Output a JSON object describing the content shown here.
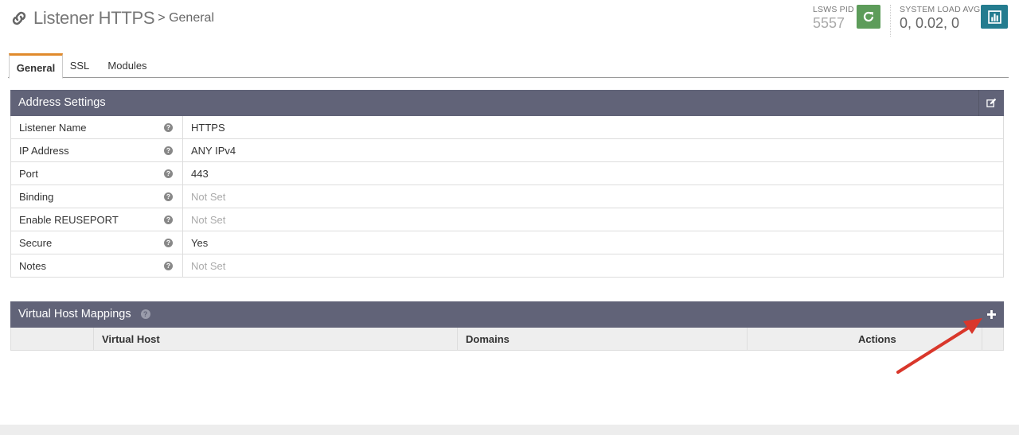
{
  "header": {
    "title": "Listener HTTPS",
    "subtitle": "> General",
    "pid_label": "LSWS PID",
    "pid_value": "5557",
    "load_label": "SYSTEM LOAD AVG",
    "load_value": "0, 0.02, 0",
    "icons": {
      "title": "link-icon",
      "restart": "refresh-icon",
      "stats": "bar-chart-icon"
    },
    "colors": {
      "restart_btn": "#5d9c5a",
      "stats_btn": "#247c8f"
    }
  },
  "tabs": [
    {
      "label": "General",
      "active": true
    },
    {
      "label": "SSL",
      "active": false
    },
    {
      "label": "Modules",
      "active": false
    }
  ],
  "address_settings": {
    "title": "Address Settings",
    "rows": [
      {
        "label": "Listener Name",
        "value": "HTTPS",
        "not_set": false
      },
      {
        "label": "IP Address",
        "value": "ANY IPv4",
        "not_set": false
      },
      {
        "label": "Port",
        "value": "443",
        "not_set": false
      },
      {
        "label": "Binding",
        "value": "Not Set",
        "not_set": true
      },
      {
        "label": "Enable REUSEPORT",
        "value": "Not Set",
        "not_set": true
      },
      {
        "label": "Secure",
        "value": "Yes",
        "not_set": false
      },
      {
        "label": "Notes",
        "value": "Not Set",
        "not_set": true
      }
    ]
  },
  "vhost_mappings": {
    "title": "Virtual Host Mappings",
    "columns": {
      "virtual_host": "Virtual Host",
      "domains": "Domains",
      "actions": "Actions"
    }
  },
  "colors": {
    "panel_header": "#616378",
    "tab_accent": "#e08a2c",
    "arrow": "#d9372b"
  }
}
